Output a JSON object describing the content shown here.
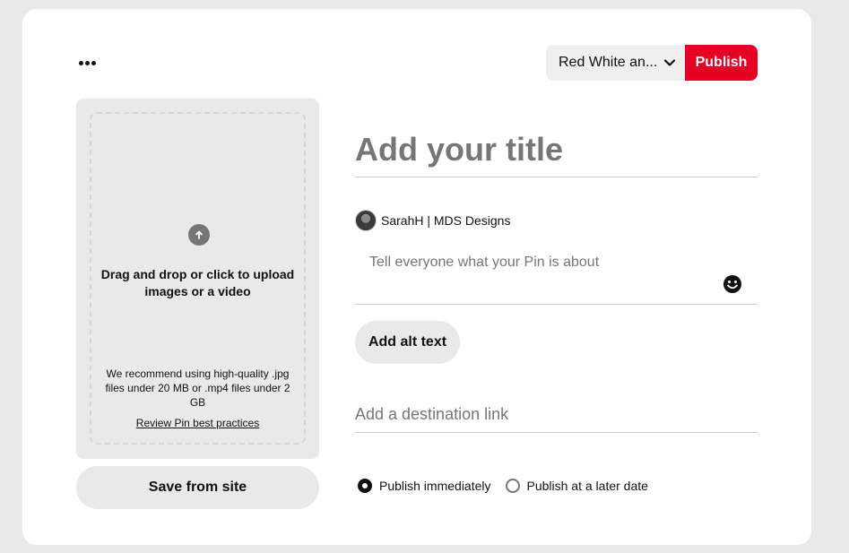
{
  "toolbar": {
    "more_icon": "more-horizontal-icon",
    "board_selected": "Red White an...",
    "publish_label": "Publish",
    "publish_color": "#e60023"
  },
  "upload": {
    "icon": "upload-arrow-icon",
    "main_text": "Drag and drop or click to upload images or a video",
    "recommend_text": "We recommend using high-quality .jpg files under 20 MB or .mp4 files under 2 GB",
    "review_link": "Review Pin best practices",
    "save_from_site_label": "Save from site"
  },
  "form": {
    "title_placeholder": "Add your title",
    "author_name": "SarahH | MDS Designs",
    "description_placeholder": "Tell everyone what your Pin is about",
    "emoji_icon": "emoji-smile-icon",
    "alt_text_label": "Add alt text",
    "destination_placeholder": "Add a destination link",
    "publish_options": [
      {
        "label": "Publish immediately",
        "selected": true
      },
      {
        "label": "Publish at a later date",
        "selected": false
      }
    ]
  }
}
